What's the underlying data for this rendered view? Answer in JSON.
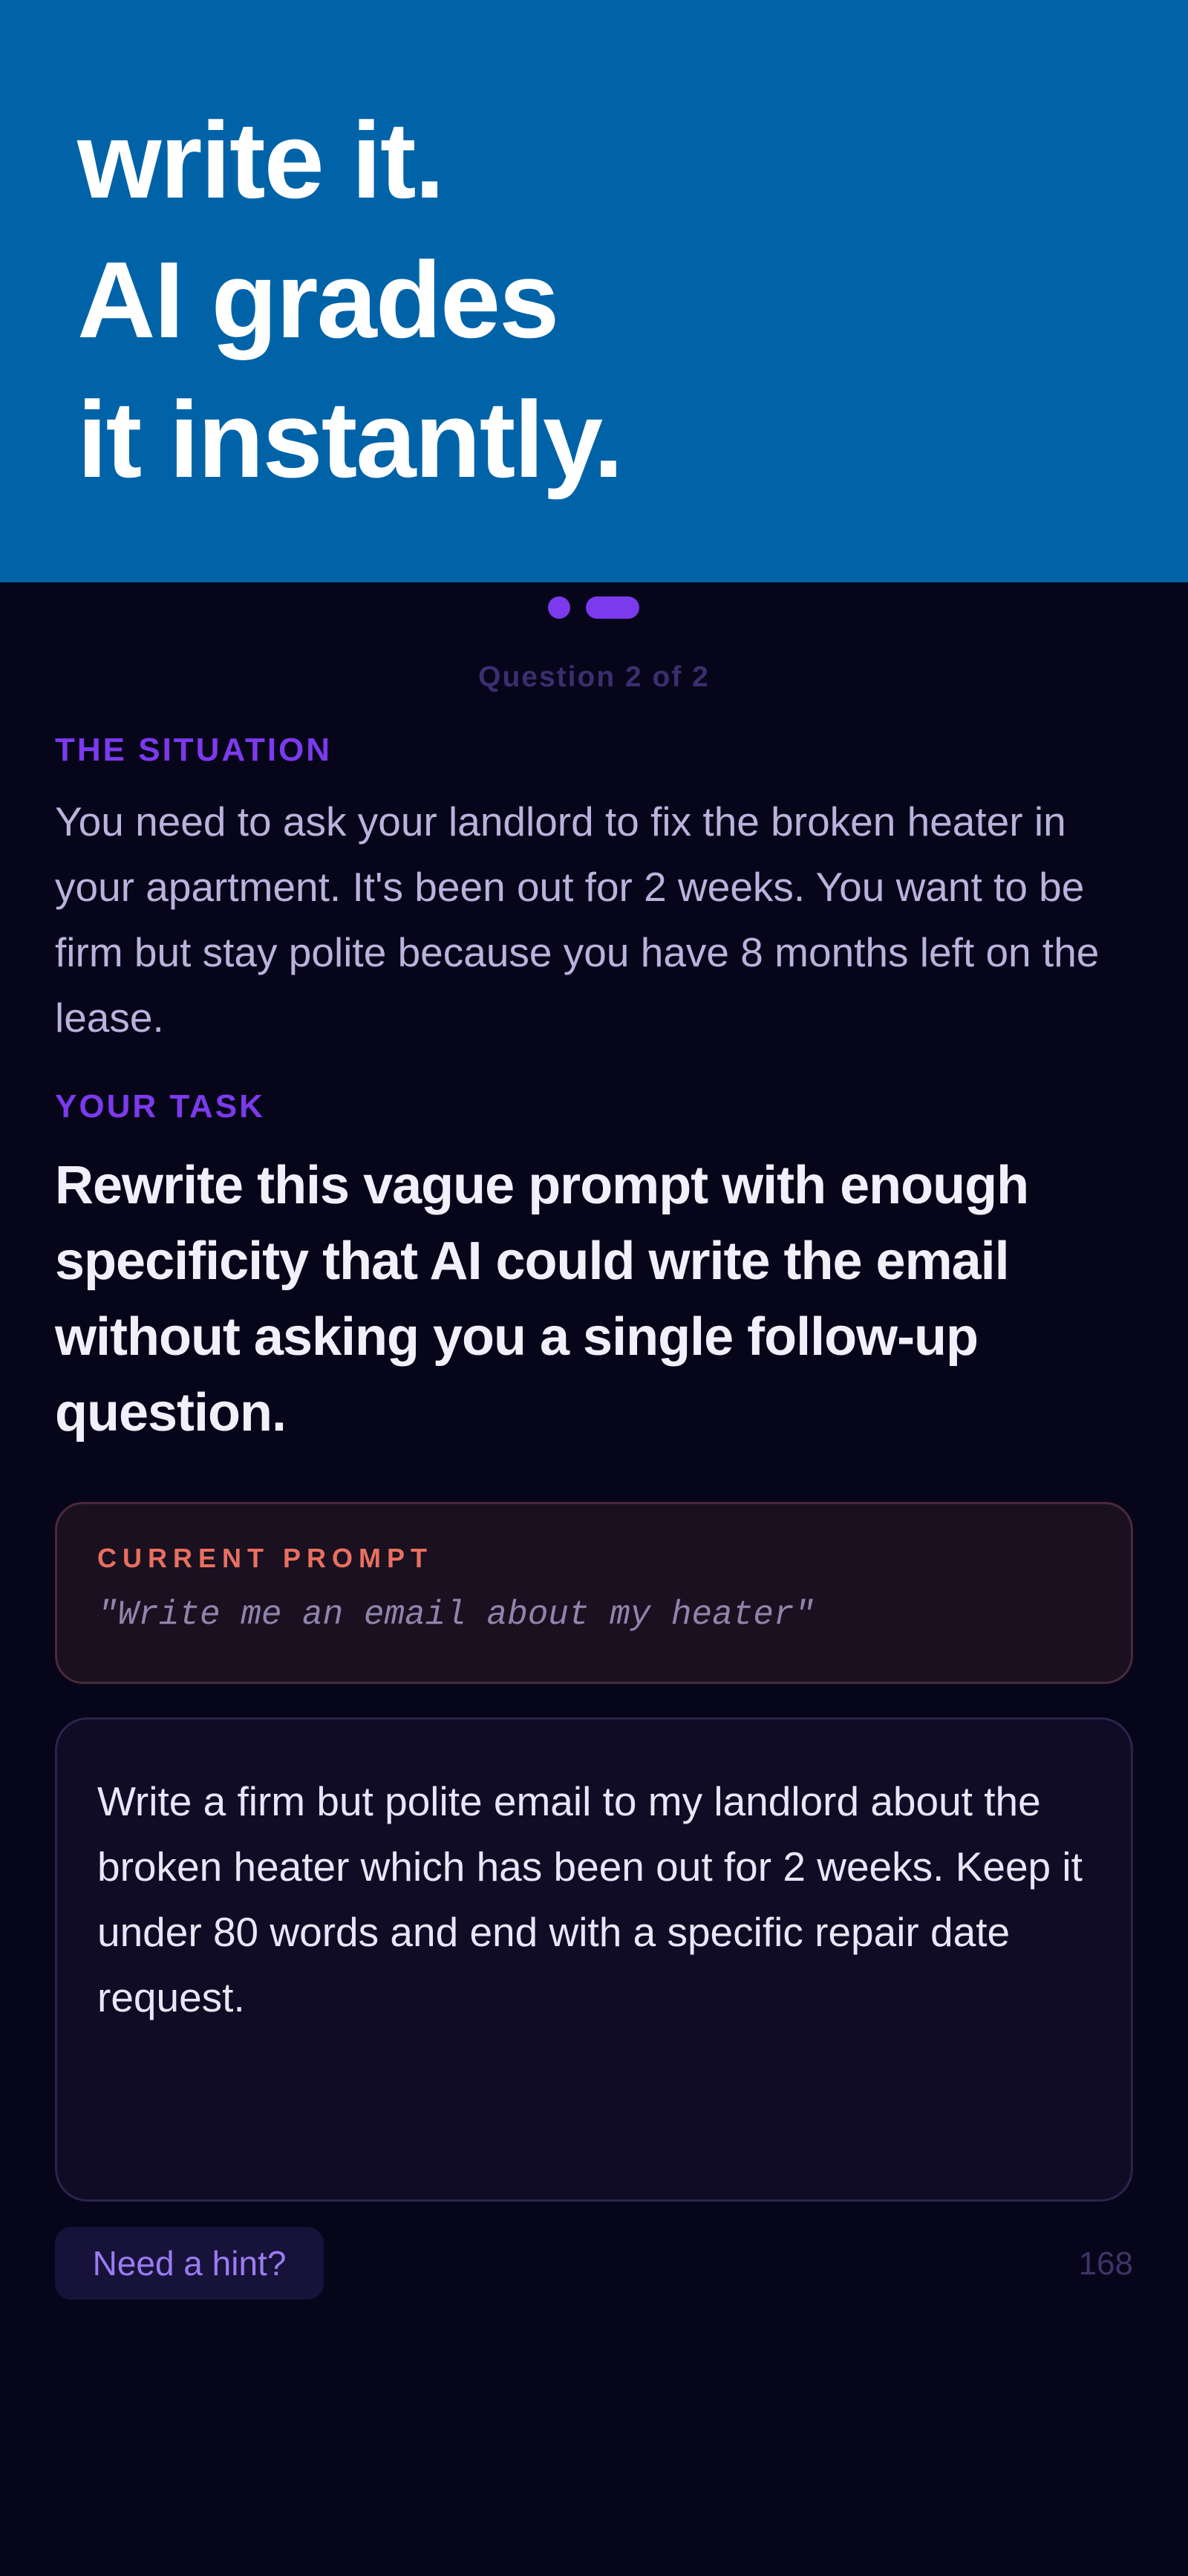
{
  "hero": {
    "line1": "write it.",
    "line2": "AI grades",
    "line3": "it instantly.",
    "background": "#0063a8"
  },
  "progress": {
    "counter": "Question 2 of 2",
    "current": 2,
    "total": 2,
    "accent": "#7c3aed"
  },
  "situation": {
    "label": "THE SITUATION",
    "text": "You need to ask your landlord to fix the broken heater in your apartment. It's been out for 2 weeks. You want to be firm but stay polite because you have 8 months left on the lease."
  },
  "task": {
    "label": "YOUR TASK",
    "text": "Rewrite this vague prompt with enough specificity that AI could write the email without asking you a single follow-up question."
  },
  "current_prompt": {
    "label": "CURRENT PROMPT",
    "value": "\"Write me an email about my heater\""
  },
  "answer": {
    "value": "Write a firm but polite email to my landlord about the broken heater which has been out for 2 weeks. Keep it under 80 words and end with a specific repair date request."
  },
  "footer": {
    "hint_label": "Need a hint?",
    "char_count": "168"
  }
}
